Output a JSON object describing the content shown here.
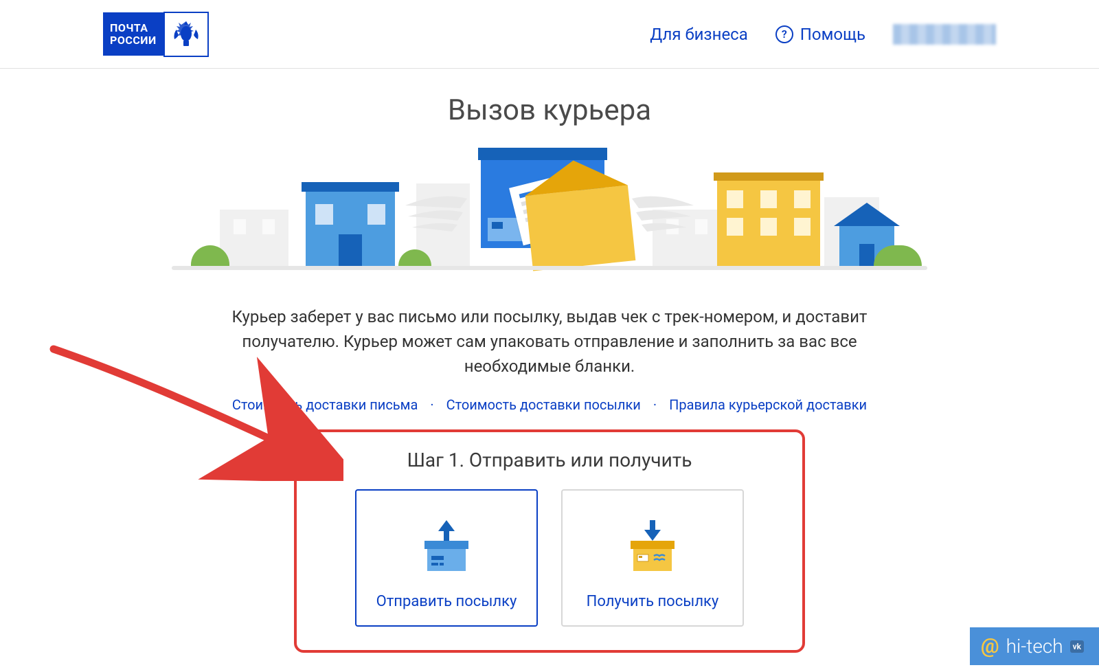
{
  "header": {
    "logo_text_line1": "ПОЧТА",
    "logo_text_line2": "РОССИИ",
    "business_link": "Для бизнеса",
    "help_link": "Помощь"
  },
  "page": {
    "title": "Вызов курьера",
    "description": "Курьер заберет у вас письмо или посылку, выдав чек с трек-номером, и доставит получателю. Курьер может сам упаковать отправление и заполнить за вас все необходимые бланки."
  },
  "links": {
    "letter_cost": "Стоимость доставки письма",
    "parcel_cost": "Стоимость доставки посылки",
    "rules": "Правила курьерской доставки"
  },
  "step": {
    "title": "Шаг 1. Отправить или получить",
    "options": {
      "send": "Отправить посылку",
      "receive": "Получить посылку"
    }
  },
  "watermark": {
    "text": "hi-tech",
    "badge": "vk"
  }
}
